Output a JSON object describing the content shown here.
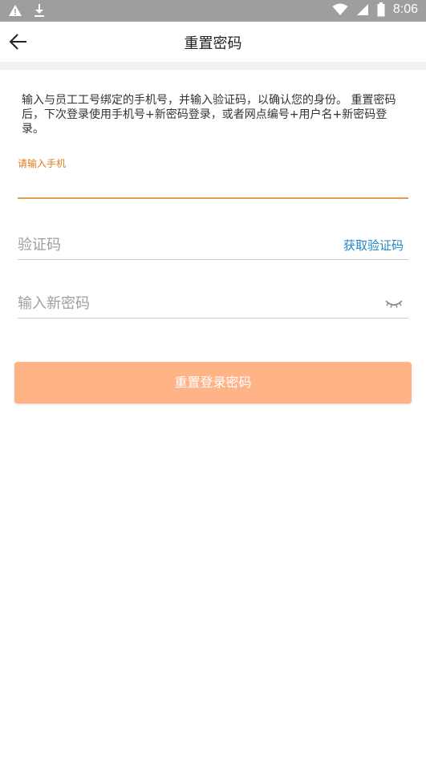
{
  "statusbar": {
    "time": "8:06",
    "icons": [
      "warning-icon",
      "download-icon",
      "wifi-icon",
      "signal-icon",
      "battery-icon"
    ]
  },
  "appbar": {
    "back_icon": "arrow-left-icon",
    "title": "重置密码"
  },
  "form": {
    "description": "输入与员工工号绑定的手机号，并输入验证码，以确认您的身份。 重置密码后，下次登录使用手机号+新密码登录，或者网点编号+用户名+新密码登录。",
    "phone_label": "请输入手机",
    "phone_value": "",
    "code_placeholder": "验证码",
    "get_code_label": "获取验证码",
    "password_placeholder": "输入新密码",
    "password_toggle_icon": "eye-closed-icon",
    "submit_label": "重置登录密码"
  },
  "colors": {
    "accent_orange": "#e07b1d",
    "button_bg": "#ffb386",
    "link_blue": "#1f86c6",
    "statusbar_bg": "#9e9e9e"
  }
}
